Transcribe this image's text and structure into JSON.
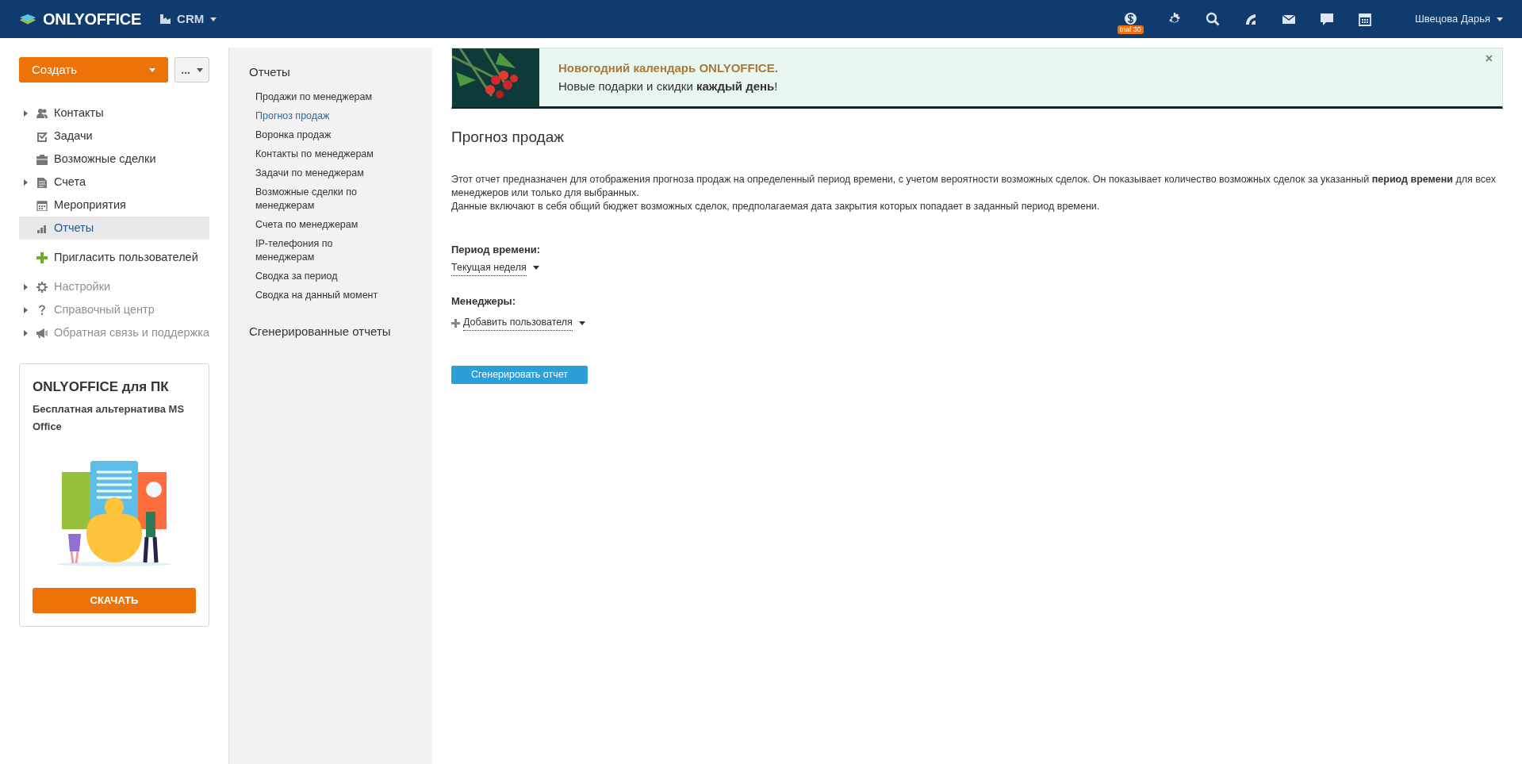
{
  "topbar": {
    "logo": "ONLYOFFICE",
    "module": "CRM",
    "trial_badge": "trial 30",
    "user": "Швецова Дарья"
  },
  "sidebar": {
    "create_button": "Создать",
    "more_button": "...",
    "items": [
      {
        "label": "Контакты",
        "kind": "module",
        "expandable": true,
        "selected": false
      },
      {
        "label": "Задачи",
        "kind": "module",
        "expandable": false,
        "selected": false
      },
      {
        "label": "Возможные сделки",
        "kind": "module",
        "expandable": false,
        "selected": false
      },
      {
        "label": "Счета",
        "kind": "module",
        "expandable": true,
        "selected": false
      },
      {
        "label": "Мероприятия",
        "kind": "module",
        "expandable": false,
        "selected": false
      },
      {
        "label": "Отчеты",
        "kind": "module",
        "expandable": false,
        "selected": true
      },
      {
        "label": "Пригласить пользователей",
        "kind": "action",
        "expandable": false,
        "selected": false
      },
      {
        "label": "Настройки",
        "kind": "service",
        "expandable": true,
        "selected": false
      },
      {
        "label": "Справочный центр",
        "kind": "service",
        "expandable": true,
        "selected": false
      },
      {
        "label": "Обратная связь и поддержка",
        "kind": "service",
        "expandable": true,
        "selected": false
      }
    ],
    "promo": {
      "title": "ONLYOFFICE для ПК",
      "subtitle": "Бесплатная альтернатива MS Office",
      "button": "СКАЧАТЬ"
    }
  },
  "reports_menu": {
    "title": "Отчеты",
    "items": [
      {
        "label": "Продажи по менеджерам",
        "selected": false
      },
      {
        "label": "Прогноз продаж",
        "selected": true
      },
      {
        "label": "Воронка продаж",
        "selected": false
      },
      {
        "label": "Контакты по менеджерам",
        "selected": false
      },
      {
        "label": "Задачи по менеджерам",
        "selected": false
      },
      {
        "label": "Возможные сделки по менеджерам",
        "selected": false
      },
      {
        "label": "Счета по менеджерам",
        "selected": false
      },
      {
        "label": "IP-телефония по менеджерам",
        "selected": false
      },
      {
        "label": "Сводка за период",
        "selected": false
      },
      {
        "label": "Сводка на данный момент",
        "selected": false
      }
    ],
    "generated": "Сгенерированные отчеты"
  },
  "banner": {
    "title": "Новогодний календарь ONLYOFFICE.",
    "text": "Новые подарки и скидки **каждый день**!",
    "close": "×"
  },
  "report": {
    "title": "Прогноз продаж",
    "description": [
      "Этот отчет предназначен для отображения прогноза продаж на определенный период времени, с учетом вероятности возможных сделок. Он показывает количество возможных сделок за указанный **период времени** для всех менеджеров или только для выбранных.",
      "Данные включают в себя общий бюджет возможных сделок, предполагаемая дата закрытия которых попадает в заданный период времени."
    ],
    "period_label": "Период времени:",
    "period_value": "Текущая неделя",
    "managers_label": "Менеджеры:",
    "add_user": "Добавить пользователя",
    "generate_button": "Сгенерировать отчет"
  }
}
